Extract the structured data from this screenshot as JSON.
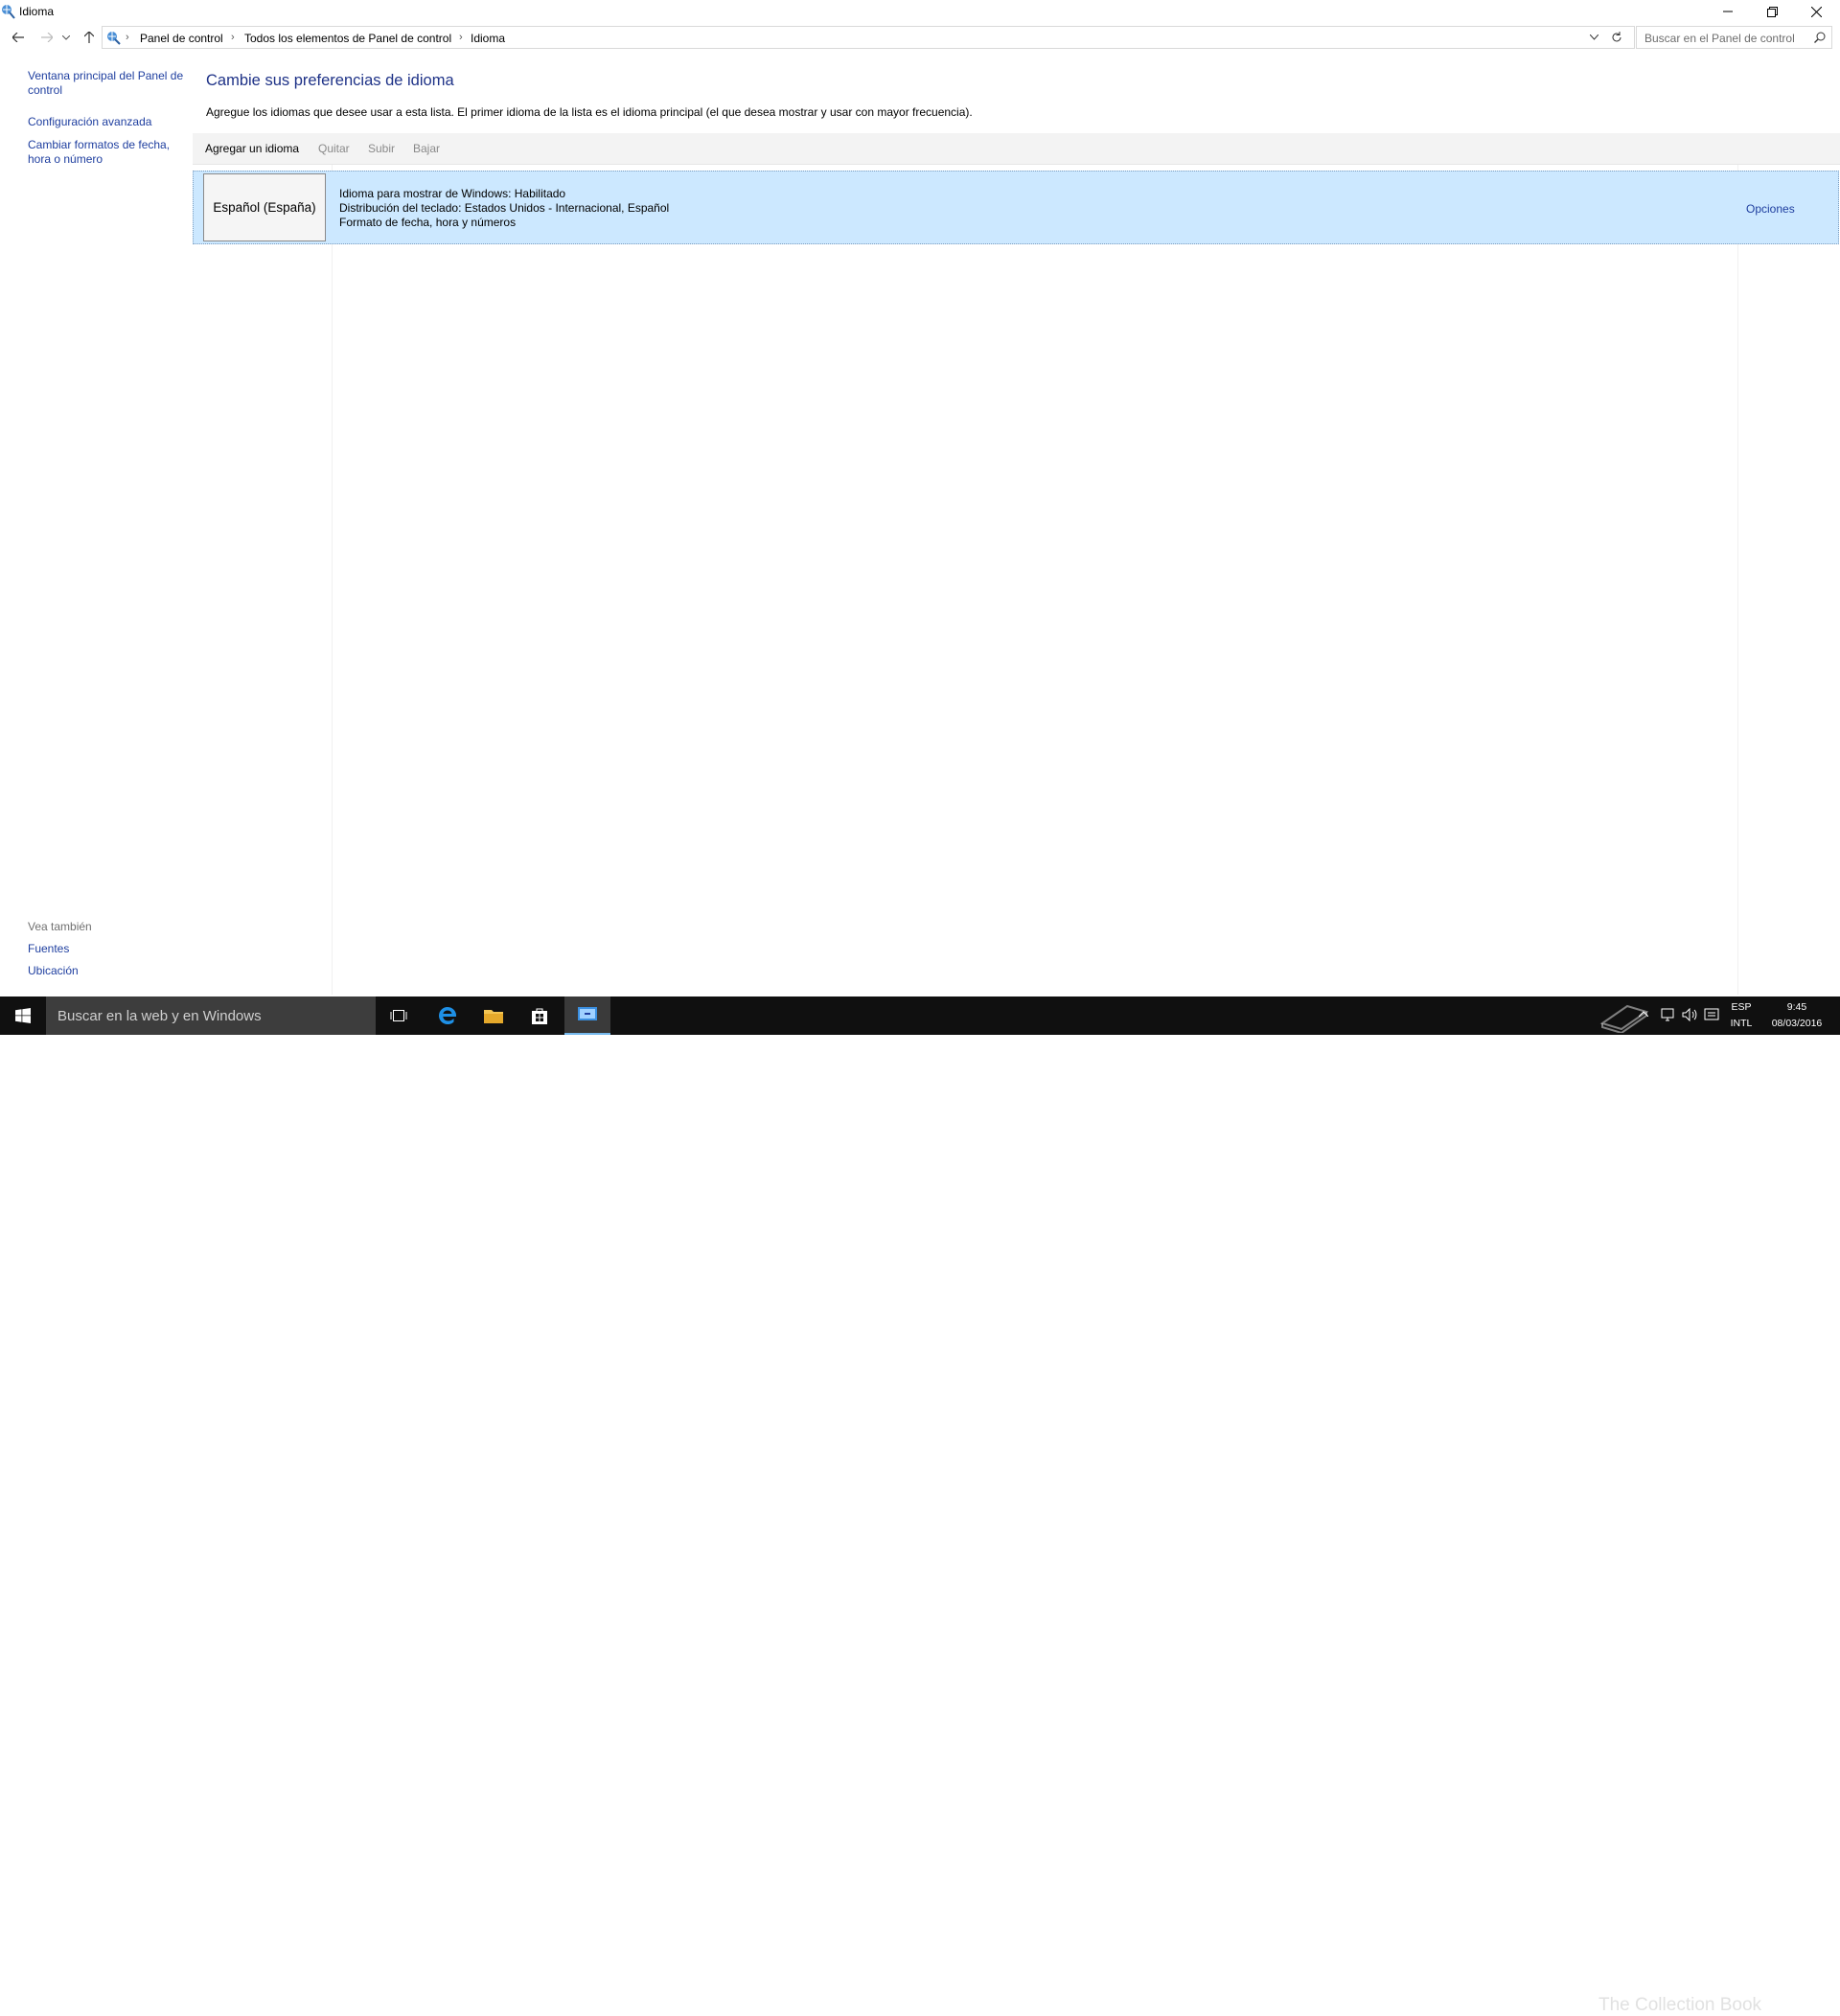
{
  "window": {
    "title": "Idioma",
    "controls": {
      "minimize": "minimize-icon",
      "restore": "restore-icon",
      "close": "close-icon"
    }
  },
  "address_bar": {
    "breadcrumbs": [
      "Panel de control",
      "Todos los elementos de Panel de control",
      "Idioma"
    ],
    "search_placeholder": "Buscar en el Panel de control"
  },
  "sidebar": {
    "links": [
      "Ventana principal del Panel de control",
      "Configuración avanzada",
      "Cambiar formatos de fecha, hora o número"
    ],
    "see_also": {
      "heading": "Vea también",
      "links": [
        "Fuentes",
        "Ubicación"
      ]
    }
  },
  "main": {
    "heading": "Cambie sus preferencias de idioma",
    "description": "Agregue los idiomas que desee usar a esta lista. El primer idioma de la lista es el idioma principal (el que desea mostrar y usar con mayor frecuencia).",
    "toolbar": {
      "add": "Agregar un idioma",
      "remove": "Quitar",
      "up": "Subir",
      "down": "Bajar"
    },
    "languages": [
      {
        "name": "Español (España)",
        "details": [
          "Idioma para mostrar de Windows: Habilitado",
          "Distribución del teclado: Estados Unidos - Internacional, Español",
          "Formato de fecha, hora y números"
        ],
        "options_label": "Opciones",
        "selected": true
      }
    ]
  },
  "taskbar": {
    "search_placeholder": "Buscar en la web y en Windows",
    "tray": {
      "lang_top": "ESP",
      "lang_bottom": "INTL",
      "time": "9:45",
      "date": "08/03/2016"
    },
    "watermark": "The Collection Book"
  },
  "colors": {
    "link": "#1e3e9f",
    "heading": "#1e3287",
    "selection": "#cce8ff",
    "taskbar": "#101010"
  }
}
